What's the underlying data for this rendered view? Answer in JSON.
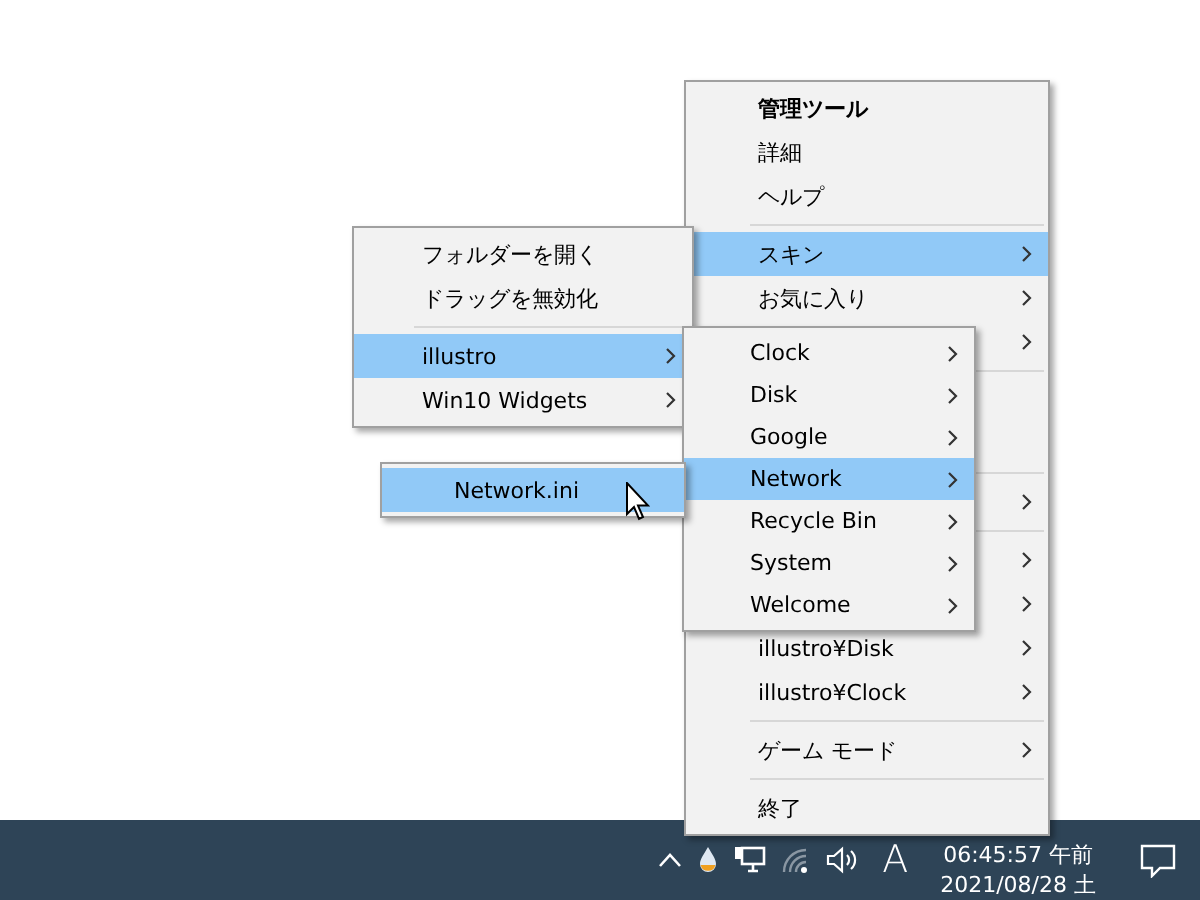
{
  "main_menu": {
    "items": [
      {
        "kind": "item",
        "label": "管理ツール",
        "bold": true,
        "submenu": false,
        "selected": false
      },
      {
        "kind": "item",
        "label": "詳細",
        "bold": false,
        "submenu": false,
        "selected": false
      },
      {
        "kind": "item",
        "label": "ヘルプ",
        "bold": false,
        "submenu": false,
        "selected": false
      },
      {
        "kind": "separator"
      },
      {
        "kind": "item",
        "label": "スキン",
        "bold": false,
        "submenu": true,
        "selected": true
      },
      {
        "kind": "item",
        "label": "お気に入り",
        "bold": false,
        "submenu": true,
        "selected": false
      },
      {
        "kind": "covered",
        "submenu": true
      },
      {
        "kind": "separator"
      },
      {
        "kind": "blank"
      },
      {
        "kind": "blank"
      },
      {
        "kind": "separator"
      },
      {
        "kind": "covered",
        "submenu": true
      },
      {
        "kind": "separator"
      },
      {
        "kind": "covered",
        "submenu": true
      },
      {
        "kind": "covered",
        "submenu": true
      },
      {
        "kind": "item",
        "label": "illustro¥Disk",
        "bold": false,
        "submenu": true,
        "selected": false
      },
      {
        "kind": "item",
        "label": "illustro¥Clock",
        "bold": false,
        "submenu": true,
        "selected": false
      },
      {
        "kind": "separator"
      },
      {
        "kind": "item",
        "label": "ゲーム モード",
        "bold": false,
        "submenu": true,
        "selected": false
      },
      {
        "kind": "separator"
      },
      {
        "kind": "item",
        "label": "終了",
        "bold": false,
        "submenu": false,
        "selected": false
      }
    ]
  },
  "skin_menu": {
    "items": [
      {
        "kind": "item",
        "label": "フォルダーを開く",
        "bold": false,
        "submenu": false,
        "selected": false
      },
      {
        "kind": "item",
        "label": "ドラッグを無効化",
        "bold": false,
        "submenu": false,
        "selected": false
      },
      {
        "kind": "separator"
      },
      {
        "kind": "item",
        "label": "illustro",
        "bold": false,
        "submenu": true,
        "selected": true
      },
      {
        "kind": "item",
        "label": "Win10 Widgets",
        "bold": false,
        "submenu": true,
        "selected": false
      }
    ]
  },
  "illustro_menu": {
    "items": [
      {
        "kind": "item",
        "label": "Clock",
        "bold": false,
        "submenu": true,
        "selected": false
      },
      {
        "kind": "item",
        "label": "Disk",
        "bold": false,
        "submenu": true,
        "selected": false
      },
      {
        "kind": "item",
        "label": "Google",
        "bold": false,
        "submenu": true,
        "selected": false
      },
      {
        "kind": "item",
        "label": "Network",
        "bold": false,
        "submenu": true,
        "selected": true
      },
      {
        "kind": "item",
        "label": "Recycle Bin",
        "bold": false,
        "submenu": true,
        "selected": false
      },
      {
        "kind": "item",
        "label": "System",
        "bold": false,
        "submenu": true,
        "selected": false
      },
      {
        "kind": "item",
        "label": "Welcome",
        "bold": false,
        "submenu": true,
        "selected": false
      }
    ]
  },
  "network_menu": {
    "items": [
      {
        "kind": "item",
        "label": "Network.ini",
        "bold": false,
        "submenu": false,
        "selected": true
      }
    ]
  },
  "taskbar": {
    "input_indicator": "A",
    "time": "06:45:57 午前",
    "date": "2021/08/28 土"
  }
}
